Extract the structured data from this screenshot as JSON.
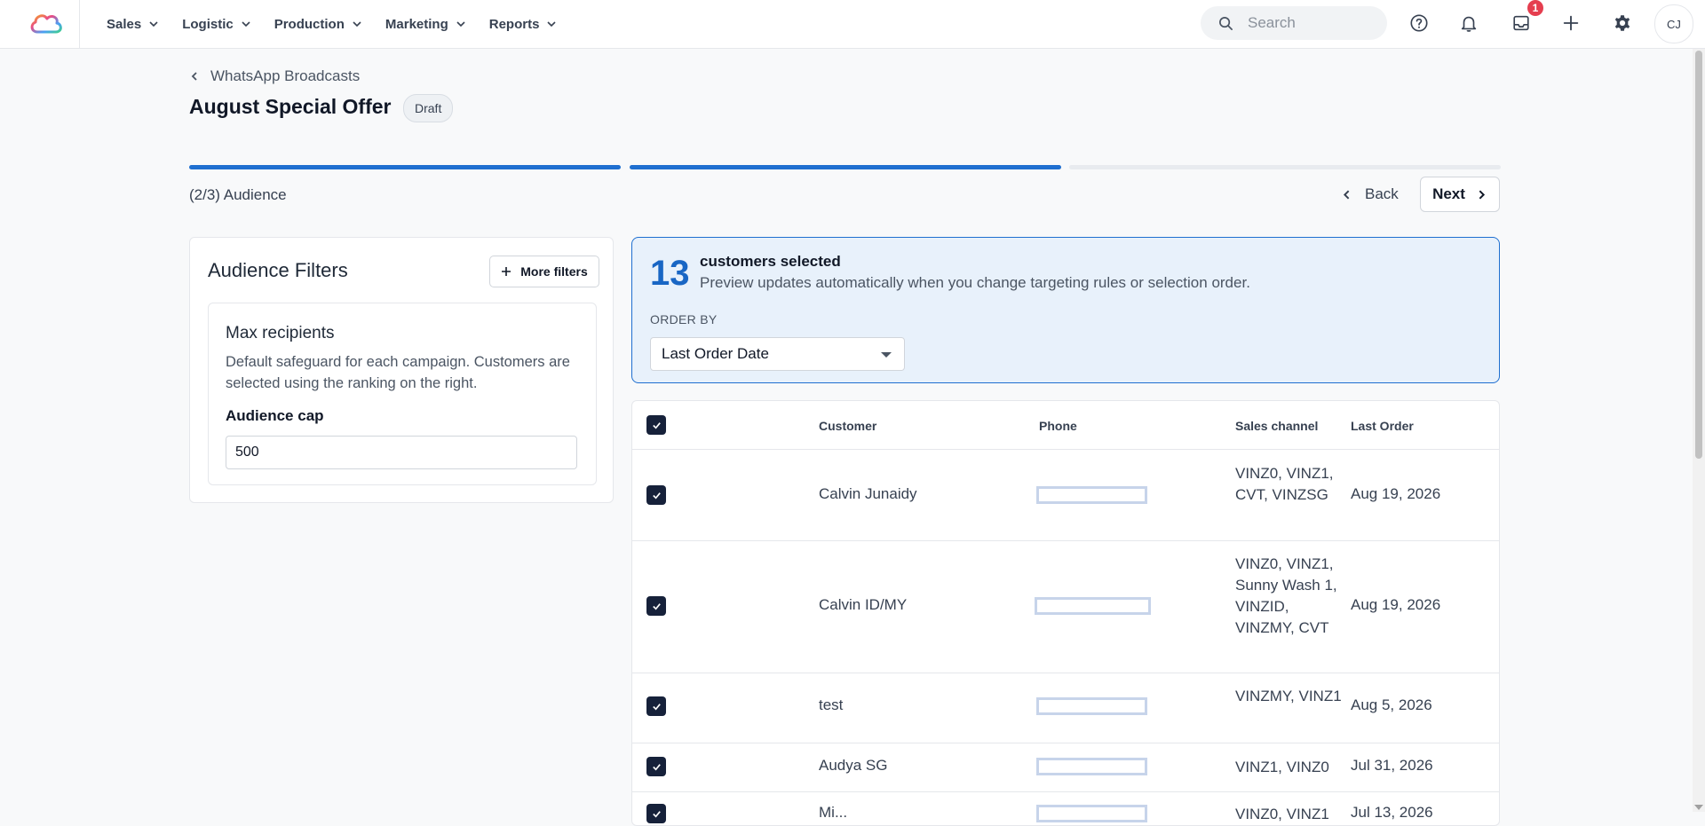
{
  "nav": {
    "menu": [
      {
        "label": "Sales"
      },
      {
        "label": "Logistic"
      },
      {
        "label": "Production"
      },
      {
        "label": "Marketing"
      },
      {
        "label": "Reports"
      }
    ],
    "search_placeholder": "Search",
    "notification_count": "1",
    "avatar_initials": "CJ"
  },
  "header": {
    "breadcrumb": "WhatsApp Broadcasts",
    "title": "August Special Offer",
    "status_badge": "Draft",
    "step_label": "(2/3) Audience",
    "back_label": "Back",
    "next_label": "Next",
    "steps_completed": 2,
    "steps_total": 3
  },
  "filters": {
    "title": "Audience Filters",
    "more_filters_label": "More filters",
    "max_recipients_title": "Max recipients",
    "max_recipients_desc": "Default safeguard for each campaign. Customers are selected using the ranking on the right.",
    "cap_label": "Audience cap",
    "cap_value": "500"
  },
  "selection": {
    "count": "13",
    "title": "customers selected",
    "description": "Preview updates automatically when you change targeting rules or selection order.",
    "order_by_label": "ORDER BY",
    "order_by_value": "Last Order Date"
  },
  "table": {
    "columns": {
      "customer": "Customer",
      "phone": "Phone",
      "sales_channel": "Sales channel",
      "last_order": "Last Order"
    },
    "rows": [
      {
        "customer": "Calvin Junaidy",
        "sales_channel": "VINZ0, VINZ1, CVT, VINZSG",
        "last_order": "Aug 19, 2026"
      },
      {
        "customer": "Calvin ID/MY",
        "sales_channel": "VINZ0, VINZ1, Sunny Wash 1, VINZID, VINZMY, CVT",
        "last_order": "Aug 19, 2026"
      },
      {
        "customer": "test",
        "sales_channel": "VINZMY, VINZ1",
        "last_order": "Aug 5, 2026"
      },
      {
        "customer": "Audya SG",
        "sales_channel": "VINZ1, VINZ0",
        "last_order": "Jul 31, 2026"
      },
      {
        "customer": "Mi...",
        "sales_channel": "VINZ0, VINZ1",
        "last_order": "Jul 13, 2026"
      }
    ]
  },
  "colors": {
    "accent": "#1966c4",
    "progress_active": "#1f6fd0",
    "progress_inactive": "#e8ebef",
    "checkbox": "#16213a",
    "badge": "#e53e4f"
  }
}
